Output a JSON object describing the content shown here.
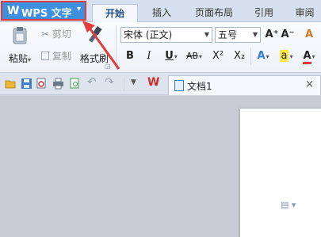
{
  "app_menu": {
    "logo": "W",
    "label": "WPS 文字",
    "caret": "▾"
  },
  "tabs": [
    {
      "label": "开始",
      "active": true
    },
    {
      "label": "插入",
      "active": false
    },
    {
      "label": "页面布局",
      "active": false
    },
    {
      "label": "引用",
      "active": false
    },
    {
      "label": "审阅",
      "active": false
    }
  ],
  "ribbon": {
    "paste": "粘贴",
    "paste_caret": "▾",
    "cut": "剪切",
    "copy": "复制",
    "format_painter": "格式刷",
    "font_name": "宋体 (正文)",
    "font_size": "五号",
    "grow_font": "A⁺",
    "shrink_font": "A⁻",
    "clear_format": "A",
    "bold": "B",
    "italic": "I",
    "underline": "U",
    "strikethrough": "AB",
    "superscript": "X²",
    "subscript": "X₂",
    "text_effect": "A",
    "highlight": "a",
    "font_color": "A",
    "accent_color": "#e23c3c"
  },
  "quick_access": {
    "icons": [
      "open-icon",
      "save-icon",
      "print-preview-icon",
      "print-icon",
      "preview-icon",
      "undo-icon",
      "redo-icon",
      "customize-icon",
      "wps-logo-icon"
    ]
  },
  "document_tab": {
    "title": "文档1",
    "close": "×"
  }
}
